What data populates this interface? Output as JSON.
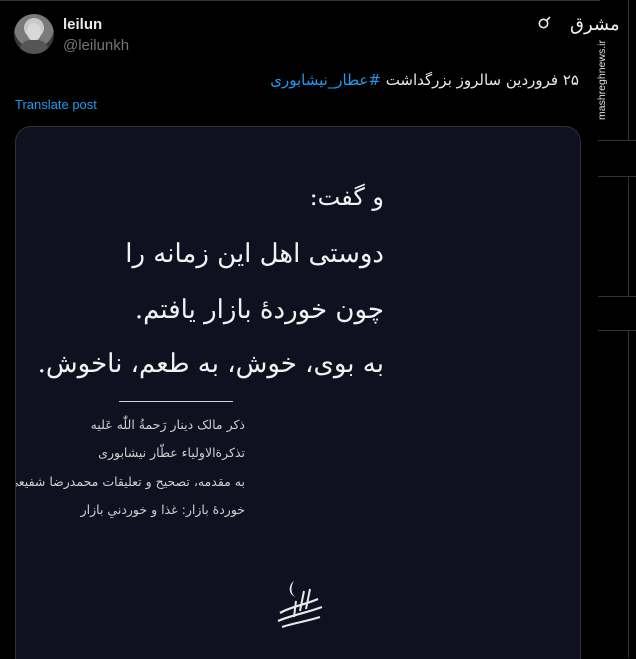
{
  "author": {
    "name": "leilun",
    "handle": "@leilunkh"
  },
  "tweet": {
    "text_prefix": "۲۵ فروردین سالروز بزرگداشت ",
    "hashtag": "#عطار_نیشابوری",
    "translate_label": "Translate post"
  },
  "media": {
    "poem": [
      "و گفت:",
      "دوستی اهل این زمانه را",
      "چون خوردهٔ بازار یافتم.",
      "به بوی، خوش، به طعم، ناخوش."
    ],
    "notes": [
      "ذکر مالک دینار رَحمةُ اللّٰه عَلیه",
      "تذکرةالاولیاء عطّار نیشابوری",
      "به مقدمه، تصحیح و تعلیقات محمدرضا شفیعی کدکنی",
      "خوردهٔ بازار: غذا و خوردنیِ بازار"
    ]
  },
  "watermark": {
    "logo": "مشرق",
    "site": "mashreghnews.ir"
  },
  "colors": {
    "background": "#000000",
    "accent": "#1d9bf0",
    "text": "#e7e9ea",
    "muted": "#71767b",
    "card_bg": "#0f1020"
  },
  "icons": [
    "grok-icon",
    "calligraphy-logo"
  ]
}
